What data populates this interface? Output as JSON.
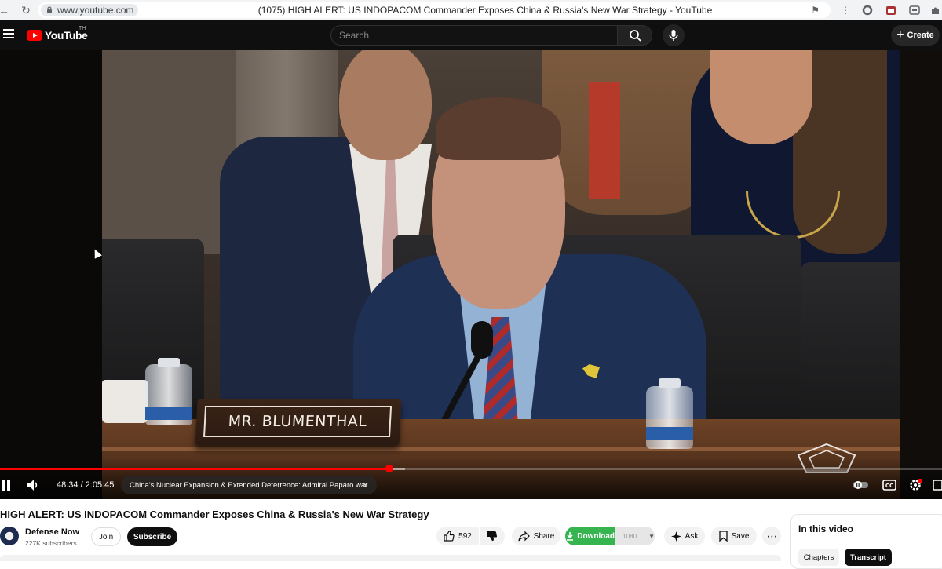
{
  "browser": {
    "url": "www.youtube.com",
    "tab_title": "(1075) HIGH ALERT: US INDOPACOM Commander Exposes China & Russia's New War Strategy - YouTube"
  },
  "header": {
    "logo_text": "YouTube",
    "country_code": "TH",
    "search_placeholder": "Search",
    "create_label": "Create"
  },
  "video": {
    "nameplate_text": "MR. BLUMENTHAL",
    "progress_played": 0.413,
    "progress_buffered": 0.43,
    "time_display": "48:34 / 2:05:45",
    "chapter_title": "China's Nuclear Expansion & Extended Deterrence: Admiral Paparo war..."
  },
  "info": {
    "title": "HIGH ALERT: US INDOPACOM Commander Exposes China & Russia's New War Strategy",
    "channel_name": "Defense Now",
    "subscribers": "227K subscribers",
    "join_label": "Join",
    "subscribe_label": "Subscribe",
    "like_count": "592",
    "share_label": "Share",
    "download_label": "Download",
    "download_quality": "1080",
    "ask_label": "Ask",
    "save_label": "Save"
  },
  "side_panel": {
    "title": "In this video",
    "chips": [
      "Chapters",
      "Transcript"
    ]
  },
  "colors": {
    "yt_red": "#ff0000",
    "download_green": "#35b450",
    "dark_bg": "#0f0f0f"
  }
}
